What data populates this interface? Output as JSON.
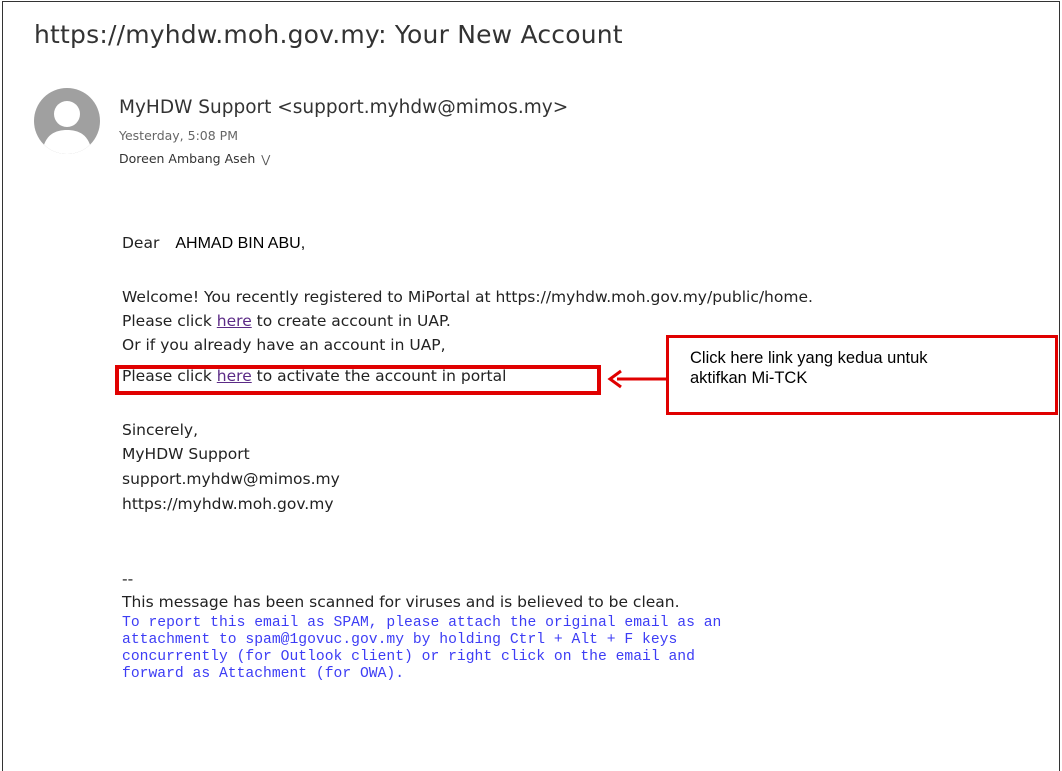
{
  "email": {
    "subject": "https://myhdw.moh.gov.my: Your New Account",
    "sender": "MyHDW Support <support.myhdw@mimos.my>",
    "time": "Yesterday, 5:08 PM",
    "recipient": "Doreen Ambang Aseh",
    "greeting": "Dear",
    "recipient_name": "AHMAD BIN ABU,",
    "welcome_line": "Welcome! You recently registered to MiPortal at https://myhdw.moh.gov.my/public/home.",
    "line2_pre": "Please click ",
    "line2_link": "here",
    "line2_post": " to create account in UAP.",
    "line3": "Or if you already have an account in UAP,",
    "line4_pre": "Please click ",
    "line4_link": "here",
    "line4_post": " to activate the account in portal",
    "sign_off": "Sincerely,",
    "sign_name": "MyHDW Support",
    "sign_email": "support.myhdw@mimos.my",
    "sign_url": "https://myhdw.moh.gov.my",
    "separator": "--",
    "scan_notice": "This message has been scanned for viruses and is believed to be clean.",
    "spam_notice": "To report this email as SPAM, please attach the original email as an\nattachment to spam@1govuc.gov.my by holding Ctrl + Alt + F keys\nconcurrently (for Outlook client) or right click on the email and\nforward as Attachment (for OWA)."
  },
  "annotation": {
    "callout_text_1": "Click here link yang kedua untuk",
    "callout_text_2": "aktifkan Mi-TCK",
    "color": "#e00000"
  },
  "icons": {
    "avatar": "default-user-avatar",
    "expand": "double-chevron-down-icon"
  }
}
